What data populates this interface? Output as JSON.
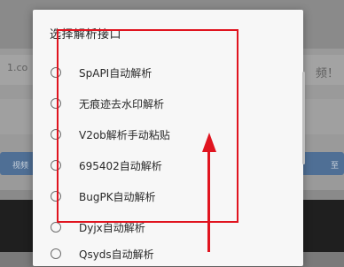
{
  "background": {
    "field_text_left": "1.co",
    "field_text_right": "频！",
    "button_left_label": "视频",
    "button_right_label": "至"
  },
  "dialog": {
    "title": "选择解析接口",
    "options": [
      {
        "label": "SpAPI自动解析"
      },
      {
        "label": "无痕迹去水印解析"
      },
      {
        "label": "V2ob解析手动粘贴"
      },
      {
        "label": "695402自动解析"
      },
      {
        "label": "BugPK自动解析"
      },
      {
        "label": "Dyjx自动解析"
      },
      {
        "label": "Qsyds自动解析"
      }
    ]
  },
  "colors": {
    "annotation": "#e0141f",
    "dialog_bg": "#f7f7f7"
  }
}
